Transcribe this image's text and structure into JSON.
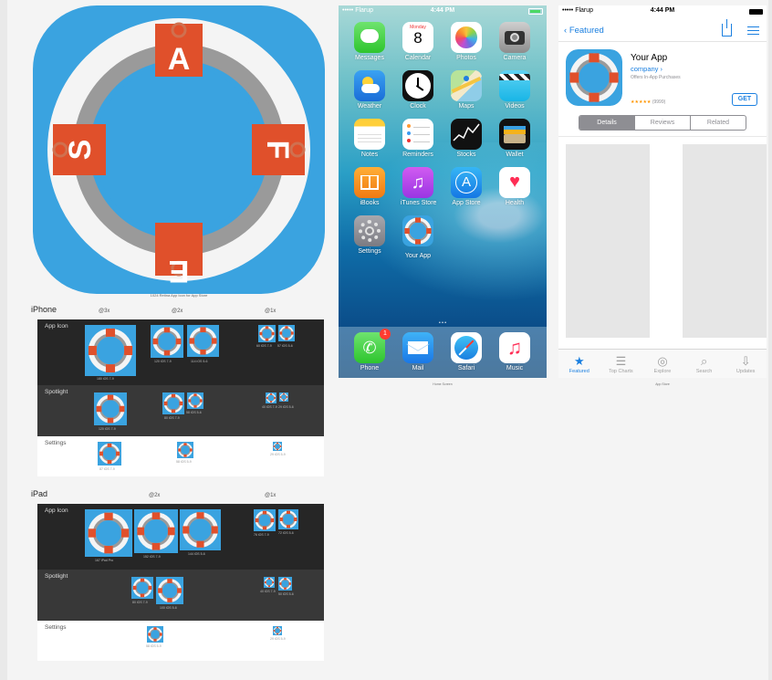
{
  "big_icon": {
    "letters": [
      "A",
      "F",
      "E",
      "S"
    ],
    "caption": "1024 Retina App Icon for App Store"
  },
  "iphone": {
    "title": "iPhone",
    "scales": [
      "@3x",
      "@2x",
      "@1x"
    ],
    "rows": [
      {
        "label": "App Icon",
        "captions": [
          "180 iOS 7-9",
          "120 iOS 7-9",
          "114 iOS 5-6",
          "60 iOS 7-9",
          "57 iOS 5-6"
        ]
      },
      {
        "label": "Spotlight",
        "captions": [
          "120 iOS 7-9",
          "80 iOS 7-9",
          "58 iOS 5-6",
          "40 iOS 7-9",
          "29 iOS 5-6"
        ]
      },
      {
        "label": "Settings",
        "captions": [
          "87 iOS 7-9",
          "58 iOS 5-9",
          "29 iOS 5-9"
        ]
      }
    ]
  },
  "ipad": {
    "title": "iPad",
    "scales": [
      "@2x",
      "@1x"
    ],
    "rows": [
      {
        "label": "App Icon",
        "captions": [
          "167 iPad Pro",
          "152 iOS 7-9",
          "144 iOS 5-6",
          "76 iOS 7-9",
          "72 iOS 5-6"
        ]
      },
      {
        "label": "Spotlight",
        "captions": [
          "80 iOS 7-9",
          "100 iOS 5-6",
          "40 iOS 7-9",
          "50 iOS 5-6"
        ]
      },
      {
        "label": "Settings",
        "captions": [
          "58 iOS 5-9",
          "29 iOS 5-9"
        ]
      }
    ]
  },
  "home_screen": {
    "status_left": "••••• Flarup",
    "time": "4:44 PM",
    "apps": [
      "Messages",
      "Calendar",
      "Photos",
      "Camera",
      "Weather",
      "Clock",
      "Maps",
      "Videos",
      "Notes",
      "Reminders",
      "Stocks",
      "Wallet",
      "iBooks",
      "iTunes Store",
      "App Store",
      "Health",
      "Settings",
      "Your App"
    ],
    "calendar_day": "Monday",
    "calendar_date": "8",
    "page_dots": "• • •",
    "dock": [
      "Phone",
      "Mail",
      "Safari",
      "Music"
    ],
    "phone_badge": "1",
    "caption": "Home Screen"
  },
  "app_store": {
    "status_left": "••••• Flarup",
    "time": "4:44 PM",
    "back_label": "Featured",
    "app_name": "Your App",
    "company": "company",
    "offers": "Offers In-App Purchases",
    "stars": "★★★★★",
    "rating_count": "(9999)",
    "get_label": "GET",
    "segments": [
      "Details",
      "Reviews",
      "Related"
    ],
    "tabs": [
      {
        "label": "Featured",
        "icon": "★"
      },
      {
        "label": "Top Charts",
        "icon": "☰"
      },
      {
        "label": "Explore",
        "icon": "◎"
      },
      {
        "label": "Search",
        "icon": "⌕"
      },
      {
        "label": "Updates",
        "icon": "⇩"
      }
    ],
    "caption": "App Store"
  },
  "colors": {
    "icon_blue": "#3aa3e0",
    "ring_white": "#f4f4f4",
    "ring_gray": "#9a9a9a",
    "ring_red": "#e0502b",
    "ios_blue": "#1a7fe0"
  }
}
